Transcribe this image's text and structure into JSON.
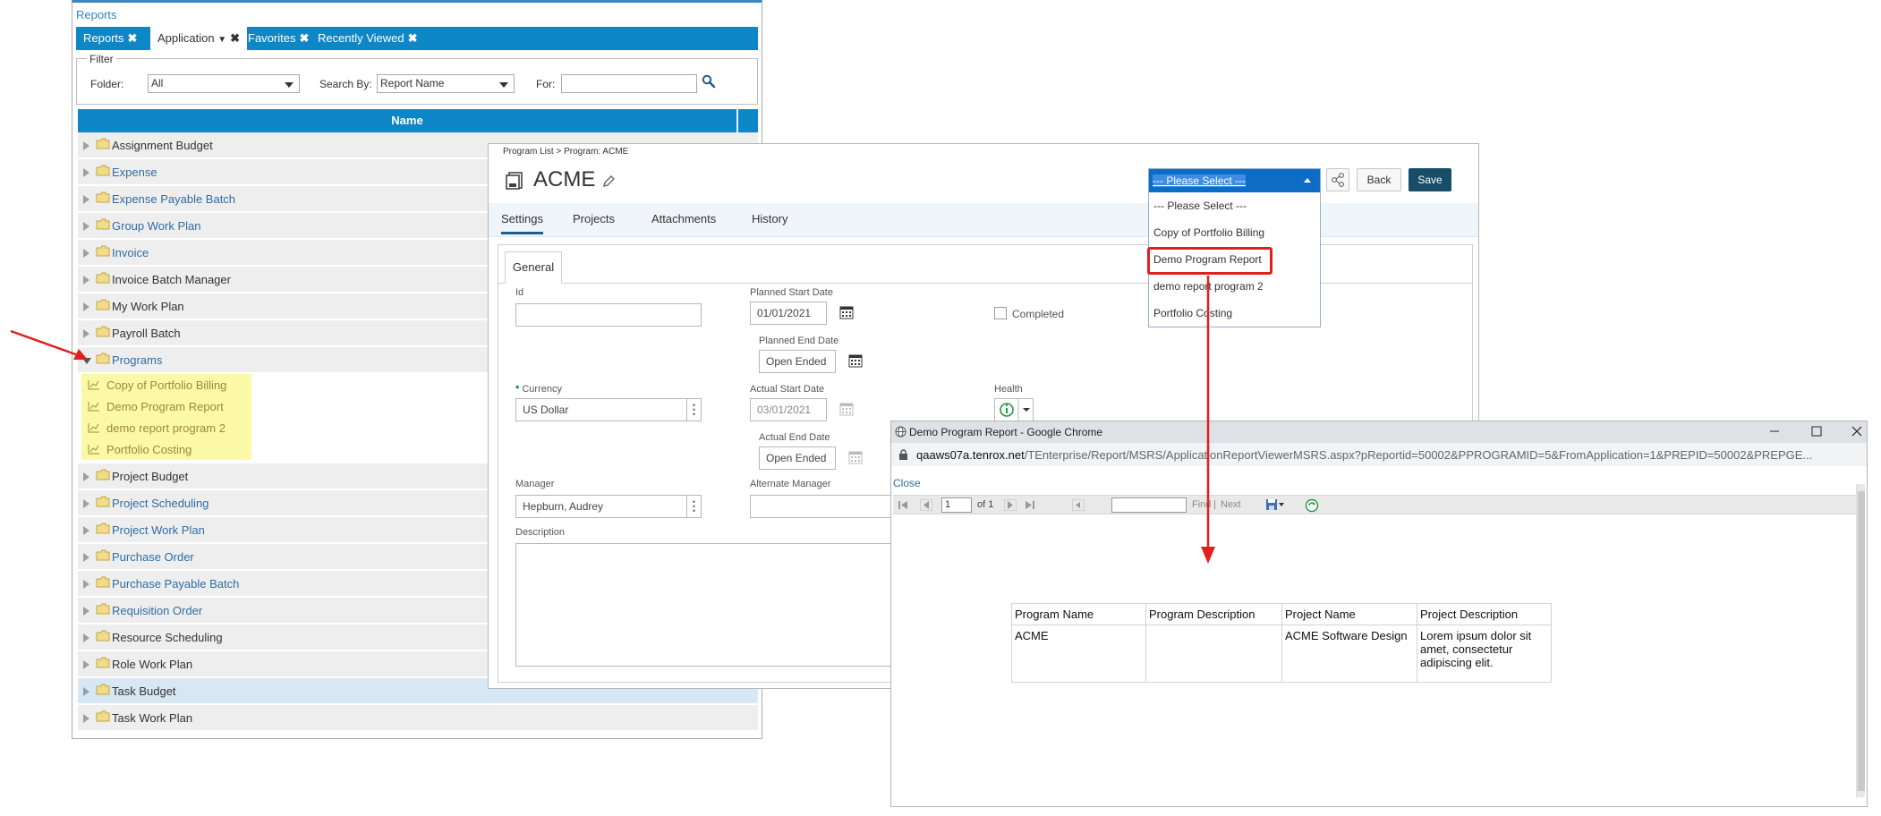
{
  "reports": {
    "title": "Reports",
    "tabs": [
      {
        "label": "Reports",
        "close": "✖"
      },
      {
        "label": "Application",
        "close": "✖"
      },
      {
        "label": "Favorites",
        "close": "✖"
      },
      {
        "label": "Recently Viewed",
        "close": "✖"
      }
    ],
    "filter": {
      "legend": "Filter",
      "folder_label": "Folder:",
      "folder_value": "All",
      "search_by_label": "Search By:",
      "search_by_value": "Report Name",
      "for_label": "For:",
      "for_value": ""
    },
    "column_header": "Name",
    "rows": [
      "Assignment Budget",
      "Expense",
      "Expense Payable Batch",
      "Group Work Plan",
      "Invoice",
      "Invoice Batch Manager",
      "My Work Plan",
      "Payroll Batch",
      "Programs",
      "Project Budget",
      "Project Scheduling",
      "Project Work Plan",
      "Purchase Order",
      "Purchase Payable Batch",
      "Requisition Order",
      "Resource Scheduling",
      "Role Work Plan",
      "Task Budget",
      "Task Work Plan"
    ],
    "program_reports": [
      "Copy of Portfolio Billing",
      "Demo Program Report",
      "demo report program 2",
      "Portfolio Costing"
    ]
  },
  "program": {
    "breadcrumb": "Program List > Program: ACME",
    "title": "ACME",
    "tabs": [
      "Settings",
      "Projects",
      "Attachments",
      "History"
    ],
    "subtab": "General",
    "fields": {
      "id_label": "Id",
      "id_value": "",
      "planned_start_label": "Planned Start Date",
      "planned_start_value": "01/01/2021",
      "planned_end_label": "Planned End Date",
      "planned_end_value": "Open Ended",
      "completed_label": "Completed",
      "currency_label": "Currency",
      "currency_value": "US Dollar",
      "actual_start_label": "Actual Start Date",
      "actual_start_value": "03/01/2021",
      "actual_end_label": "Actual End Date",
      "actual_end_value": "Open Ended",
      "health_label": "Health",
      "manager_label": "Manager",
      "manager_value": "Hepburn, Audrey",
      "alt_manager_label": "Alternate Manager",
      "alt_manager_value": "",
      "description_label": "Description"
    },
    "buttons": {
      "back": "Back",
      "save": "Save"
    },
    "report_dropdown": {
      "selected": "--- Please Select ---",
      "options": [
        "--- Please Select ---",
        "Copy of Portfolio Billing",
        "Demo Program Report",
        "demo report program 2",
        "Portfolio Costing"
      ]
    }
  },
  "chrome": {
    "title": "Demo Program Report - Google Chrome",
    "url_host": "qaaws07a.tenrox.net",
    "url_path": "/TEnterprise/Report/MSRS/ApplicationReportViewerMSRS.aspx?pReportid=50002&PPROGRAMID=5&FromApplication=1&PREPID=50002&PREPGE...",
    "close_link": "Close",
    "toolbar": {
      "page": "1",
      "of": "of 1",
      "find": "Find",
      "next": "Next",
      "separator": "|"
    },
    "table": {
      "headers": [
        "Program Name",
        "Program Description",
        "Project Name",
        "Project Description"
      ],
      "rows": [
        [
          "ACME",
          "",
          "ACME Software Design",
          "Lorem ipsum dolor sit amet, consectetur adipiscing elit."
        ]
      ]
    }
  },
  "colors": {
    "tab_blue": "#0f86c6",
    "highlight_yellow": "#fbf9a6",
    "annotation_red": "#e21e1e",
    "save_button": "#174d67",
    "dropdown_header": "#0e6cc4"
  }
}
